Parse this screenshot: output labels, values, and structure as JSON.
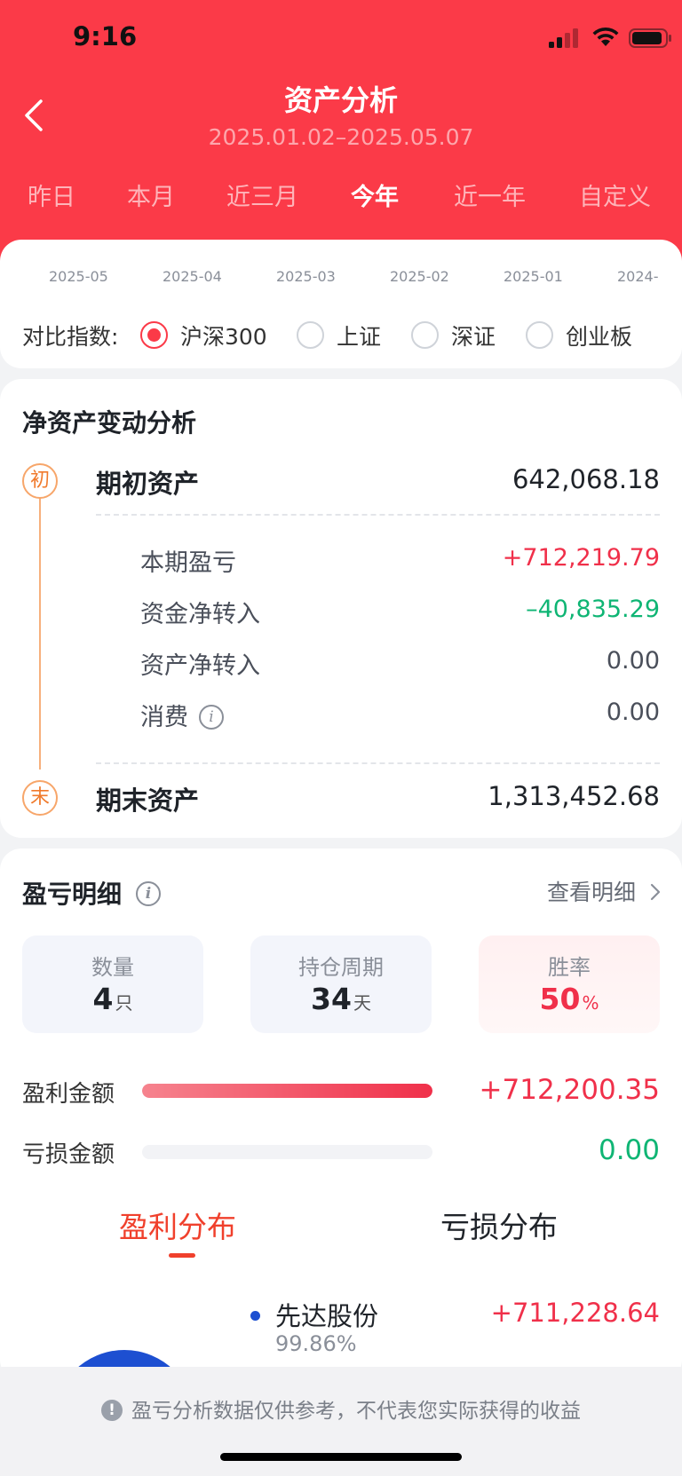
{
  "status_bar": {
    "time": "9:16"
  },
  "header": {
    "title": "资产分析",
    "date_range": "2025.01.02–2025.05.07",
    "tabs": [
      {
        "label": "昨日",
        "active": false
      },
      {
        "label": "本月",
        "active": false
      },
      {
        "label": "近三月",
        "active": false
      },
      {
        "label": "今年",
        "active": true
      },
      {
        "label": "近一年",
        "active": false
      },
      {
        "label": "自定义",
        "active": false
      }
    ]
  },
  "chart_axis": {
    "labels": [
      "2025-05",
      "2025-04",
      "2025-03",
      "2025-02",
      "2025-01",
      "2024-"
    ]
  },
  "compare": {
    "label": "对比指数:",
    "options": [
      {
        "label": "沪深300",
        "checked": true
      },
      {
        "label": "上证",
        "checked": false
      },
      {
        "label": "深证",
        "checked": false
      },
      {
        "label": "创业板",
        "checked": false
      }
    ]
  },
  "net_asset": {
    "title": "净资产变动分析",
    "start_marker": "初",
    "end_marker": "末",
    "start_label": "期初资产",
    "start_value": "642,068.18",
    "items": [
      {
        "label": "本期盈亏",
        "value": "+712,219.79",
        "color": "#f0304a"
      },
      {
        "label": "资金净转入",
        "value": "–40,835.29",
        "color": "#0fb574"
      },
      {
        "label": "资产净转入",
        "value": "0.00",
        "color": "#4a4f5a"
      },
      {
        "label": "消费",
        "value": "0.00",
        "color": "#4a4f5a"
      }
    ],
    "end_label": "期末资产",
    "end_value": "1,313,452.68"
  },
  "pnl_detail": {
    "title": "盈亏明细",
    "view_link": "查看明细",
    "stats": [
      {
        "label": "数量",
        "value": "4",
        "unit": "只"
      },
      {
        "label": "持仓周期",
        "value": "34",
        "unit": "天"
      },
      {
        "label": "胜率",
        "value": "50",
        "unit": "%"
      }
    ],
    "profit_label": "盈利金额",
    "profit_value": "+712,200.35",
    "profit_ratio": 1.0,
    "loss_label": "亏损金额",
    "loss_value": "0.00",
    "loss_ratio": 0.0
  },
  "distribution": {
    "tabs": [
      {
        "label": "盈利分布",
        "active": true
      },
      {
        "label": "亏损分布",
        "active": false
      }
    ],
    "items": [
      {
        "name": "先达股份",
        "percent": "99.86%",
        "value": "+711,228.64",
        "color": "#1d4fd1"
      }
    ]
  },
  "footer": {
    "note": "盈亏分析数据仅供参考，不代表您实际获得的收益"
  },
  "colors": {
    "brand_red": "#fb3a48",
    "profit_red": "#f0304a",
    "loss_green": "#0fb574",
    "accent_orange": "#f0402c"
  }
}
